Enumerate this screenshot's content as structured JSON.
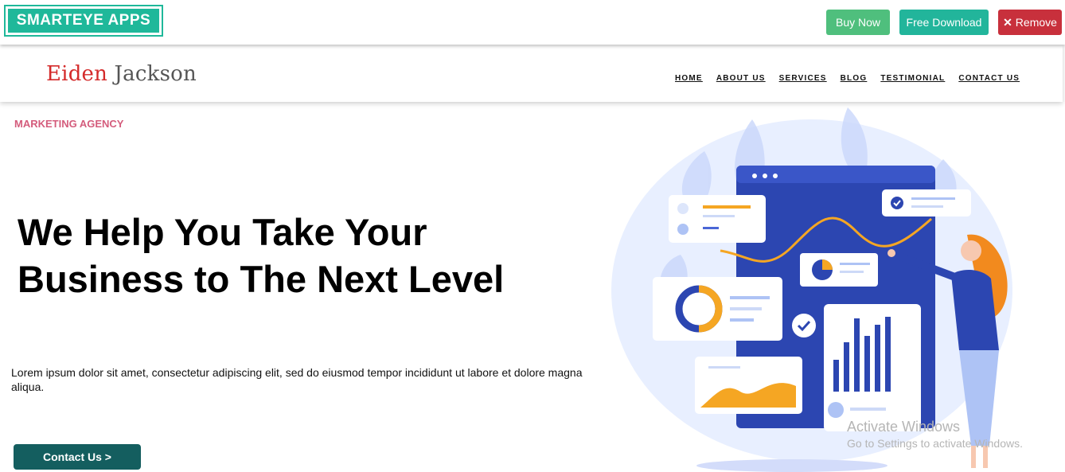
{
  "promo_bar": {
    "brand": "SMARTEYE APPS",
    "buy_now": "Buy Now",
    "free_download": "Free Download",
    "remove": "Remove"
  },
  "site": {
    "logo_first": "Eiden",
    "logo_last": "Jackson",
    "nav": [
      "HOME",
      "ABOUT US",
      "SERVICES",
      "BLOG",
      "TESTIMONIAL",
      "CONTACT US"
    ]
  },
  "hero": {
    "eyebrow": "MARKETING AGENCY",
    "headline_line1": "We Help You Take Your",
    "headline_line2": "Business to The Next Level",
    "lead": "Lorem ipsum dolor sit amet, consectetur adipiscing elit, sed do eiusmod tempor incididunt ut labore et dolore magna aliqua.",
    "cta": "Contact Us >"
  },
  "watermark": {
    "line1": "Activate Windows",
    "line2": "Go to Settings to activate Windows."
  },
  "colors": {
    "brand_teal": "#1fb89a",
    "buy_green": "#4fbf7d",
    "remove_red": "#c8303c",
    "cta_teal": "#145e5f",
    "eyebrow_pink": "#d45c7c",
    "illustration_blue": "#2c46b1",
    "illustration_orange": "#f5a623"
  }
}
